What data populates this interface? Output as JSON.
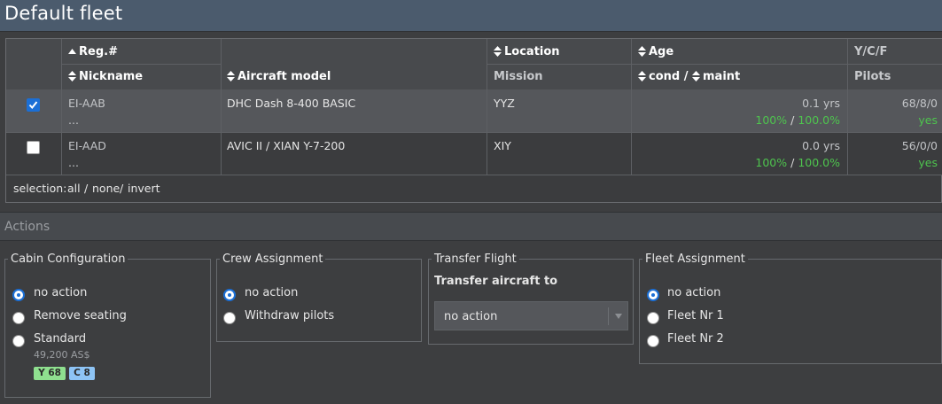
{
  "page": {
    "title": "Default fleet"
  },
  "table": {
    "headers": {
      "reg": "Reg.#",
      "nickname": "Nickname",
      "aircraft_model": "Aircraft model",
      "location": "Location",
      "mission": "Mission",
      "age": "Age",
      "cond": "cond",
      "slash": "/",
      "maint": "maint",
      "ycf": "Y/C/F",
      "pilots": "Pilots"
    },
    "rows": [
      {
        "selected": true,
        "reg": "EI-AAB",
        "nickname": "...",
        "model": "DHC Dash 8-400 BASIC",
        "location": "YYZ",
        "age": "0.1 yrs",
        "cond": "100%",
        "sep": "/",
        "maint": "100.0%",
        "ycf": "68/8/0",
        "pilots": "yes"
      },
      {
        "selected": false,
        "reg": "EI-AAD",
        "nickname": "...",
        "model": "AVIC II / XIAN Y-7-200",
        "location": "XIY",
        "age": "0.0 yrs",
        "cond": "100%",
        "sep": "/",
        "maint": "100.0%",
        "ycf": "56/0/0",
        "pilots": "yes"
      }
    ],
    "selection": {
      "label": "selection:",
      "all": "all",
      "sep1": "/",
      "none": "none",
      "sep2": "/",
      "invert": "invert"
    }
  },
  "actions": {
    "title": "Actions",
    "cabin": {
      "legend": "Cabin Configuration",
      "options": [
        "no action",
        "Remove seating",
        "Standard"
      ],
      "selected": 0,
      "standard_price": "49,200 AS$",
      "tags": [
        "Y 68",
        "C 8"
      ]
    },
    "crew": {
      "legend": "Crew Assignment",
      "options": [
        "no action",
        "Withdraw pilots"
      ],
      "selected": 0
    },
    "transfer": {
      "legend": "Transfer Flight",
      "label": "Transfer aircraft to",
      "select_value": "no action"
    },
    "fleet": {
      "legend": "Fleet Assignment",
      "options": [
        "no action",
        "Fleet Nr 1",
        "Fleet Nr 2"
      ],
      "selected": 0
    }
  },
  "colors": {
    "accent": "#1b6fd6",
    "green": "#4ec44e",
    "header": "#4b5b6d"
  },
  "icons": {
    "sort": "sort-arrows-icon",
    "check": "checkmark-icon",
    "dropdown": "chevron-down-icon"
  }
}
